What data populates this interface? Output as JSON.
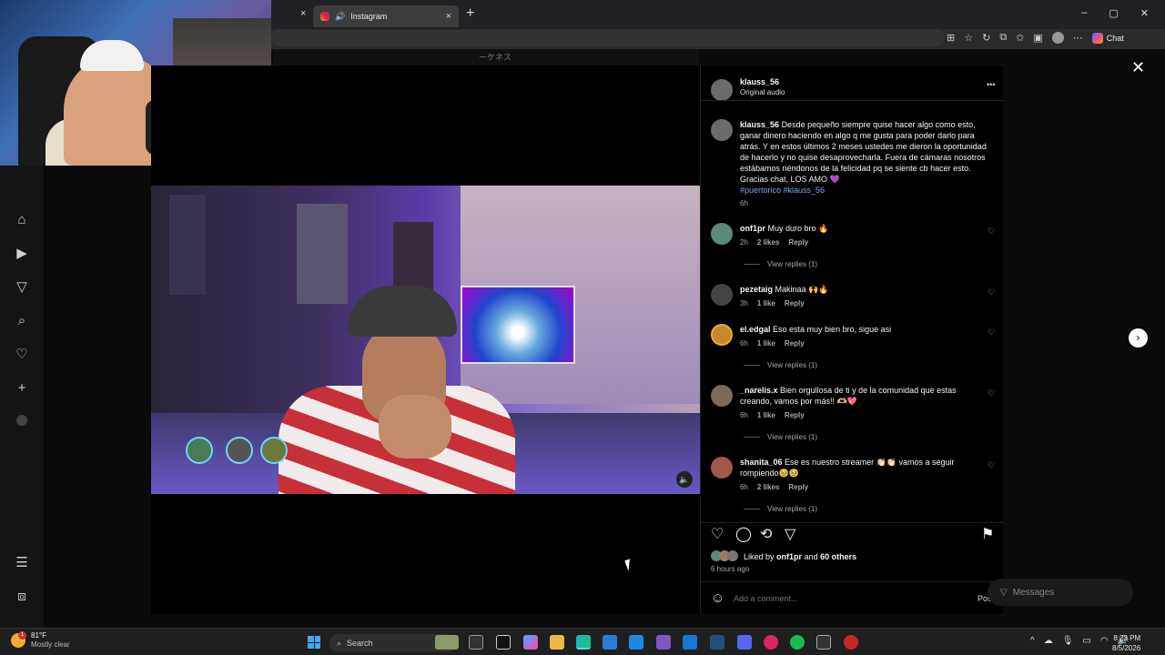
{
  "browser": {
    "tab_title": "Instagram",
    "tab_close": "×",
    "new_tab": "+",
    "chat_label": "Chat",
    "win_min": "–",
    "win_max": "▢",
    "win_close": "✕"
  },
  "page": {
    "strip_text": "ーケネス"
  },
  "post": {
    "author": "klauss_56",
    "audio": "Original audio",
    "more": "•••",
    "caption_user": "klauss_56",
    "caption": "Desde pequeño siempre quise hacer algo como esto, ganar dinero haciendo en algo q me gusta para poder darlo para atrás. Y en estos últimos 2 meses ustedes me dieron la oportunidad de hacerlo y no quise desaprovecharla. Fuera de cámaras nosotros estábamos riéndonos de la felicidad pq se siente cb hacer esto. Gracias chat, LOS AMO 💜",
    "hashtags": "#puertorico #klauss_56",
    "caption_time": "6h",
    "liked_prefix": "Liked by",
    "liked_user": "onf1pr",
    "liked_and": "and",
    "liked_others": "60 others",
    "posted_ago": "6 hours ago",
    "add_comment_placeholder": "Add a comment...",
    "post_button": "Post"
  },
  "comments": [
    {
      "user": "onf1pr",
      "text": "Muy duro bro 🔥",
      "time": "2h",
      "likes": "2 likes",
      "reply": "Reply",
      "view_replies": "View replies (1)"
    },
    {
      "user": "pezetaig",
      "text": "Makinaa 🙌🔥",
      "time": "3h",
      "likes": "1 like",
      "reply": "Reply",
      "view_replies": ""
    },
    {
      "user": "el.edgal",
      "text": "Eso esta muy bien bro, sigue asi",
      "time": "6h",
      "likes": "1 like",
      "reply": "Reply",
      "view_replies": "View replies (1)"
    },
    {
      "user": "_narelis.x",
      "text": "Bien orgullosa de ti y de la comunidad que estas creando, vamos por más!! 🫶🏼💖",
      "time": "6h",
      "likes": "1 like",
      "reply": "Reply",
      "view_replies": "View replies (1)"
    },
    {
      "user": "shanita_06",
      "text": "Ese es nuestro streamer 👏🏻👏🏻 vamos a seguir rompiendo🥹🥹",
      "time": "6h",
      "likes": "2 likes",
      "reply": "Reply",
      "view_replies": "View replies (1)"
    }
  ],
  "messages": {
    "label": "Messages"
  },
  "taskbar": {
    "temp": "81°F",
    "condition": "Mostly clear",
    "weather_badge": "1",
    "search_label": "Search",
    "time": "8:23 PM",
    "date": "8/5/2026"
  },
  "colors": {
    "accent_link": "#7fa8e8",
    "panel_bg": "#000000",
    "like_heart": "#f5f5f5"
  }
}
